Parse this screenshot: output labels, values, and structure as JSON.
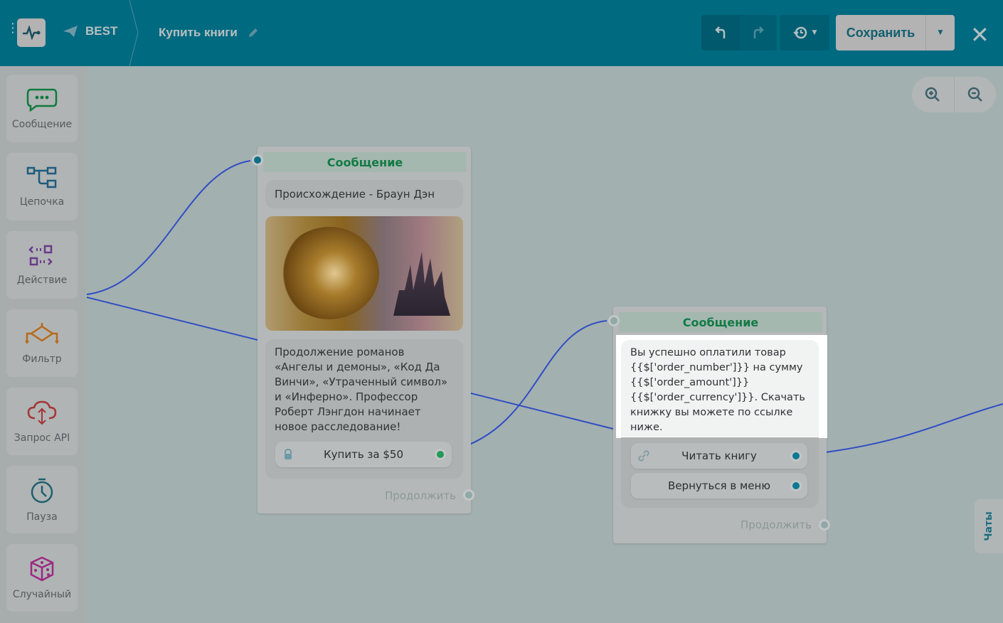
{
  "header": {
    "bot_name": "BEST",
    "flow_title": "Купить книги",
    "save_label": "Сохранить"
  },
  "sidebar": {
    "items": [
      {
        "label": "Сообщение",
        "icon": "message-icon",
        "color": "#0f7a3e"
      },
      {
        "label": "Цепочка",
        "icon": "chain-icon",
        "color": "#1d5b7e"
      },
      {
        "label": "Действие",
        "icon": "action-icon",
        "color": "#6b3a8a"
      },
      {
        "label": "Фильтр",
        "icon": "filter-icon",
        "color": "#b86a1a"
      },
      {
        "label": "Запрос API",
        "icon": "api-icon",
        "color": "#a43535"
      },
      {
        "label": "Пауза",
        "icon": "clock-icon",
        "color": "#1f5f70"
      },
      {
        "label": "Случайный",
        "icon": "dice-icon",
        "color": "#9a2a82"
      }
    ]
  },
  "nodes": [
    {
      "title": "Сообщение",
      "heading": "Происхождение - Браун Дэн",
      "text": "Продолжение романов «Ангелы и демоны», «Код Да Винчи», «Утраченный символ» и «Инферно». Профессор Роберт Лэнгдон начинает новое расследование!",
      "buttons": [
        "Купить за $50"
      ],
      "continue": "Продолжить"
    },
    {
      "title": "Сообщение",
      "text": "Вы успешно оплатили товар {{$['order_number']}} на сумму {{$['order_amount']}} {{$['order_currency']}}. Скачать книжку вы можете по ссылке ниже.",
      "buttons": [
        "Читать книгу",
        "Вернуться в меню"
      ],
      "continue": "Продолжить"
    }
  ],
  "chats_label": "Чаты"
}
